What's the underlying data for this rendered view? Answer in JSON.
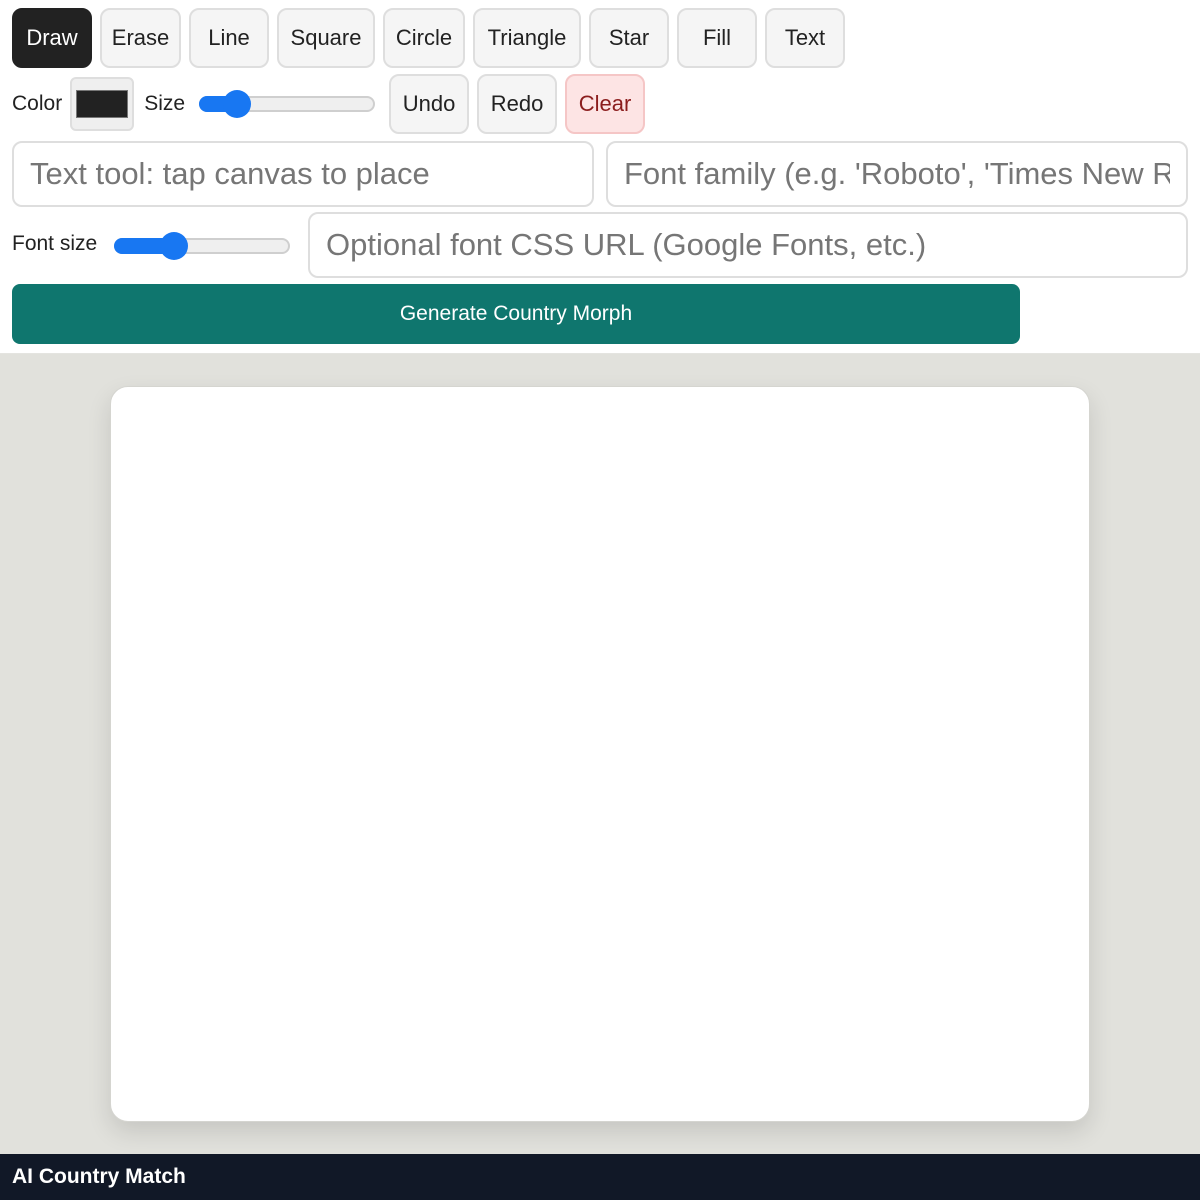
{
  "tools": [
    {
      "label": "Draw",
      "active": true
    },
    {
      "label": "Erase"
    },
    {
      "label": "Line"
    },
    {
      "label": "Square"
    },
    {
      "label": "Circle"
    },
    {
      "label": "Triangle"
    },
    {
      "label": "Star"
    },
    {
      "label": "Fill"
    },
    {
      "label": "Text"
    }
  ],
  "controls": {
    "color_label": "Color",
    "color_value": "#222222",
    "size_label": "Size",
    "size_level": 0.16,
    "undo_label": "Undo",
    "redo_label": "Redo",
    "clear_label": "Clear"
  },
  "text_tool": {
    "text_placeholder": "Text tool: tap canvas to place",
    "font_family_placeholder": "Font family (e.g. 'Roboto', 'Times New Roman')",
    "font_size_label": "Font size",
    "font_size_level": 0.31,
    "font_url_placeholder": "Optional font CSS URL (Google Fonts, etc.)"
  },
  "generate_label": "Generate Country Morph",
  "footer_title": "AI Country Match",
  "colors": {
    "accent": "#0f766e",
    "slider": "#1877f2",
    "footer": "#111827",
    "stage": "#e1e1dc",
    "danger": "#8b1d1d"
  }
}
